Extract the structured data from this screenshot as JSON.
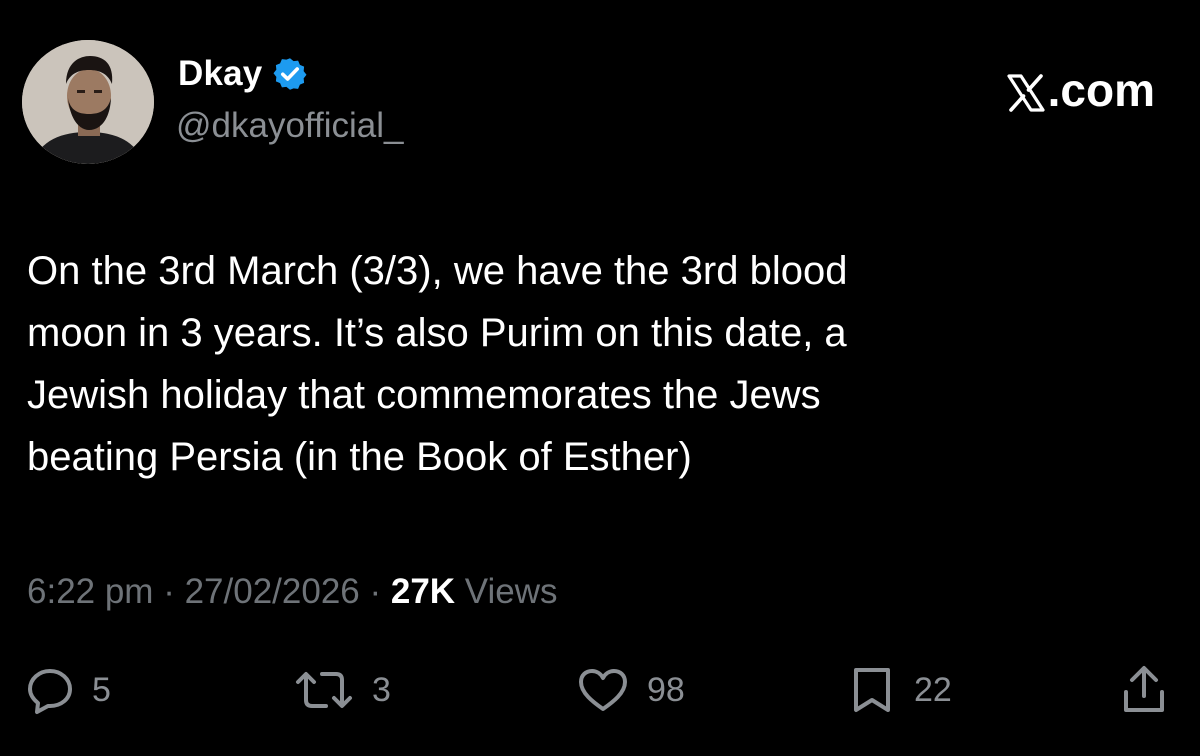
{
  "author": {
    "display_name": "Dkay",
    "handle": "@dkayofficial_",
    "verified": true,
    "verified_color": "#1d9bf0"
  },
  "brand": {
    "label": ".com",
    "icon": "x-logo-icon"
  },
  "tweet": {
    "text_lines": [
      "On the 3rd March (3/3), we have the 3rd blood",
      "moon in 3 years. It’s also Purim on this date, a",
      "Jewish holiday that commemorates the Jews",
      "beating Persia (in the Book of Esther)"
    ]
  },
  "meta": {
    "time": "6:22 pm",
    "date": "27/02/2026",
    "separator": " · ",
    "views_count": "27K",
    "views_label": " Views"
  },
  "actions": {
    "replies": {
      "icon": "reply-icon",
      "count": "5"
    },
    "reposts": {
      "icon": "repost-icon",
      "count": "3"
    },
    "likes": {
      "icon": "heart-icon",
      "count": "98"
    },
    "bookmarks": {
      "icon": "bookmark-icon",
      "count": "22"
    },
    "share": {
      "icon": "share-icon"
    }
  },
  "colors": {
    "background": "#000000",
    "text_primary": "#ffffff",
    "text_secondary": "#8b8f94",
    "accent": "#1d9bf0"
  }
}
